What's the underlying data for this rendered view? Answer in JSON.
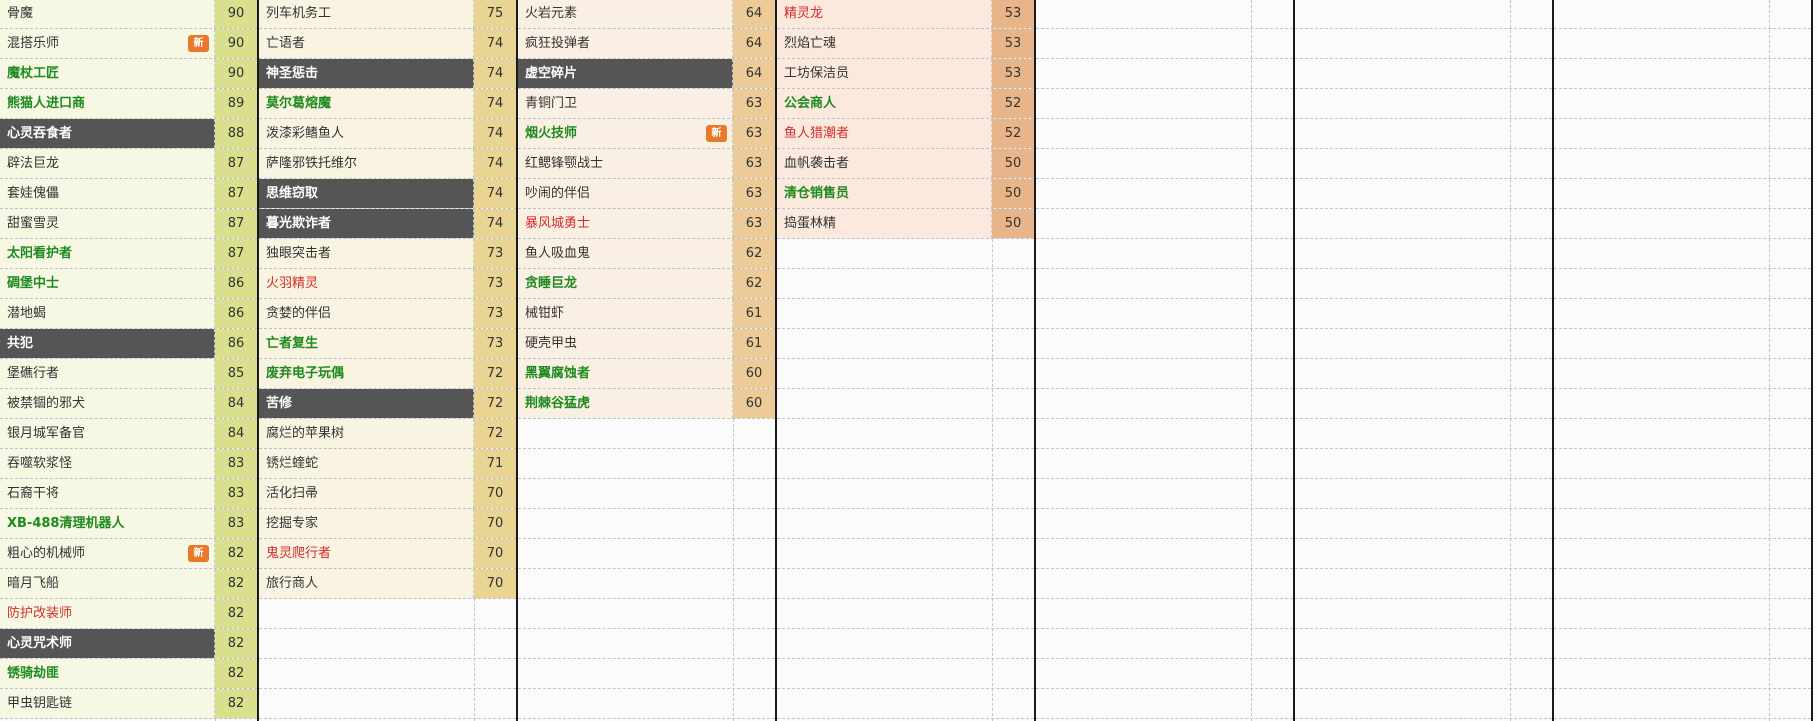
{
  "colors": {
    "normal": "#333333",
    "green": "#1f8a1f",
    "red": "#d42d2d",
    "new_badge": "#e8782a",
    "group_bg": [
      "#f6f8e4",
      "#f9f3e1",
      "#faefe3",
      "#fbe9dd"
    ],
    "score_bg": [
      "#d9df8c",
      "#e9d493",
      "#eccb99",
      "#e8b58a"
    ]
  },
  "badge_label": "新",
  "groups": [
    {
      "rows": [
        {
          "name": "骨魔",
          "score": "90",
          "style": "normal",
          "new": false
        },
        {
          "name": "混搭乐师",
          "score": "90",
          "style": "normal",
          "new": true
        },
        {
          "name": "魔杖工匠",
          "score": "90",
          "style": "green",
          "new": false
        },
        {
          "name": "熊猫人进口商",
          "score": "89",
          "style": "green",
          "new": false
        },
        {
          "name": "心灵吞食者",
          "score": "88",
          "style": "dark",
          "new": false
        },
        {
          "name": "辟法巨龙",
          "score": "87",
          "style": "normal",
          "new": false
        },
        {
          "name": "套娃傀儡",
          "score": "87",
          "style": "normal",
          "new": false
        },
        {
          "name": "甜蜜雪灵",
          "score": "87",
          "style": "normal",
          "new": false
        },
        {
          "name": "太阳看护者",
          "score": "87",
          "style": "green",
          "new": false
        },
        {
          "name": "碉堡中士",
          "score": "86",
          "style": "green",
          "new": false
        },
        {
          "name": "潜地蝎",
          "score": "86",
          "style": "normal",
          "new": false
        },
        {
          "name": "共犯",
          "score": "86",
          "style": "dark",
          "new": false
        },
        {
          "name": "堡礁行者",
          "score": "85",
          "style": "normal",
          "new": false
        },
        {
          "name": "被禁锢的邪犬",
          "score": "84",
          "style": "normal",
          "new": false
        },
        {
          "name": "银月城军备官",
          "score": "84",
          "style": "normal",
          "new": false
        },
        {
          "name": "吞噬软浆怪",
          "score": "83",
          "style": "normal",
          "new": false
        },
        {
          "name": "石裔干将",
          "score": "83",
          "style": "normal",
          "new": false
        },
        {
          "name": "XB-488清理机器人",
          "score": "83",
          "style": "green",
          "new": false
        },
        {
          "name": "粗心的机械师",
          "score": "82",
          "style": "normal",
          "new": true
        },
        {
          "name": "暗月飞船",
          "score": "82",
          "style": "normal",
          "new": false
        },
        {
          "name": "防护改装师",
          "score": "82",
          "style": "red",
          "new": false
        },
        {
          "name": "心灵咒术师",
          "score": "82",
          "style": "dark",
          "new": false
        },
        {
          "name": "锈骑劫匪",
          "score": "82",
          "style": "green",
          "new": false
        },
        {
          "name": "甲虫钥匙链",
          "score": "82",
          "style": "normal",
          "new": false
        }
      ]
    },
    {
      "rows": [
        {
          "name": "列车机务工",
          "score": "75",
          "style": "normal",
          "new": false
        },
        {
          "name": "亡语者",
          "score": "74",
          "style": "normal",
          "new": false
        },
        {
          "name": "神圣惩击",
          "score": "74",
          "style": "dark",
          "new": false
        },
        {
          "name": "莫尔葛熔魔",
          "score": "74",
          "style": "green",
          "new": false
        },
        {
          "name": "泼漆彩鳍鱼人",
          "score": "74",
          "style": "normal",
          "new": false
        },
        {
          "name": "萨隆邪铁托维尔",
          "score": "74",
          "style": "normal",
          "new": false
        },
        {
          "name": "思维窃取",
          "score": "74",
          "style": "dark",
          "new": false
        },
        {
          "name": "暮光欺诈者",
          "score": "74",
          "style": "dark",
          "new": false
        },
        {
          "name": "独眼突击者",
          "score": "73",
          "style": "normal",
          "new": false
        },
        {
          "name": "火羽精灵",
          "score": "73",
          "style": "red",
          "new": false
        },
        {
          "name": "贪婪的伴侣",
          "score": "73",
          "style": "normal",
          "new": false
        },
        {
          "name": "亡者复生",
          "score": "73",
          "style": "green",
          "new": false
        },
        {
          "name": "废弃电子玩偶",
          "score": "72",
          "style": "green",
          "new": false
        },
        {
          "name": "苦修",
          "score": "72",
          "style": "dark",
          "new": false
        },
        {
          "name": "腐烂的苹果树",
          "score": "72",
          "style": "normal",
          "new": false
        },
        {
          "name": "锈烂蝰蛇",
          "score": "71",
          "style": "normal",
          "new": false
        },
        {
          "name": "活化扫帚",
          "score": "70",
          "style": "normal",
          "new": false
        },
        {
          "name": "挖掘专家",
          "score": "70",
          "style": "normal",
          "new": false
        },
        {
          "name": "鬼灵爬行者",
          "score": "70",
          "style": "red",
          "new": false
        },
        {
          "name": "旅行商人",
          "score": "70",
          "style": "normal",
          "new": false
        }
      ]
    },
    {
      "rows": [
        {
          "name": "火岩元素",
          "score": "64",
          "style": "normal",
          "new": false
        },
        {
          "name": "疯狂投弹者",
          "score": "64",
          "style": "normal",
          "new": false
        },
        {
          "name": "虚空碎片",
          "score": "64",
          "style": "dark",
          "new": false
        },
        {
          "name": "青铜门卫",
          "score": "63",
          "style": "normal",
          "new": false
        },
        {
          "name": "烟火技师",
          "score": "63",
          "style": "green",
          "new": true
        },
        {
          "name": "红鳃锋颚战士",
          "score": "63",
          "style": "normal",
          "new": false
        },
        {
          "name": "吵闹的伴侣",
          "score": "63",
          "style": "normal",
          "new": false
        },
        {
          "name": "暴风城勇士",
          "score": "63",
          "style": "red",
          "new": false
        },
        {
          "name": "鱼人吸血鬼",
          "score": "62",
          "style": "normal",
          "new": false
        },
        {
          "name": "贪睡巨龙",
          "score": "62",
          "style": "green",
          "new": false
        },
        {
          "name": "械钳虾",
          "score": "61",
          "style": "normal",
          "new": false
        },
        {
          "name": "硬壳甲虫",
          "score": "61",
          "style": "normal",
          "new": false
        },
        {
          "name": "黑翼腐蚀者",
          "score": "60",
          "style": "green",
          "new": false
        },
        {
          "name": "荆棘谷猛虎",
          "score": "60",
          "style": "green",
          "new": false
        }
      ]
    },
    {
      "rows": [
        {
          "name": "精灵龙",
          "score": "53",
          "style": "red",
          "new": false
        },
        {
          "name": "烈焰亡魂",
          "score": "53",
          "style": "normal",
          "new": false
        },
        {
          "name": "工坊保洁员",
          "score": "53",
          "style": "normal",
          "new": false
        },
        {
          "name": "公会商人",
          "score": "52",
          "style": "green",
          "new": false
        },
        {
          "name": "鱼人猎潮者",
          "score": "52",
          "style": "red",
          "new": false
        },
        {
          "name": "血帆袭击者",
          "score": "50",
          "style": "normal",
          "new": false
        },
        {
          "name": "清仓销售员",
          "score": "50",
          "style": "green",
          "new": false
        },
        {
          "name": "捣蛋林精",
          "score": "50",
          "style": "normal",
          "new": false
        }
      ]
    },
    {
      "rows": []
    },
    {
      "rows": []
    },
    {
      "rows": []
    }
  ]
}
